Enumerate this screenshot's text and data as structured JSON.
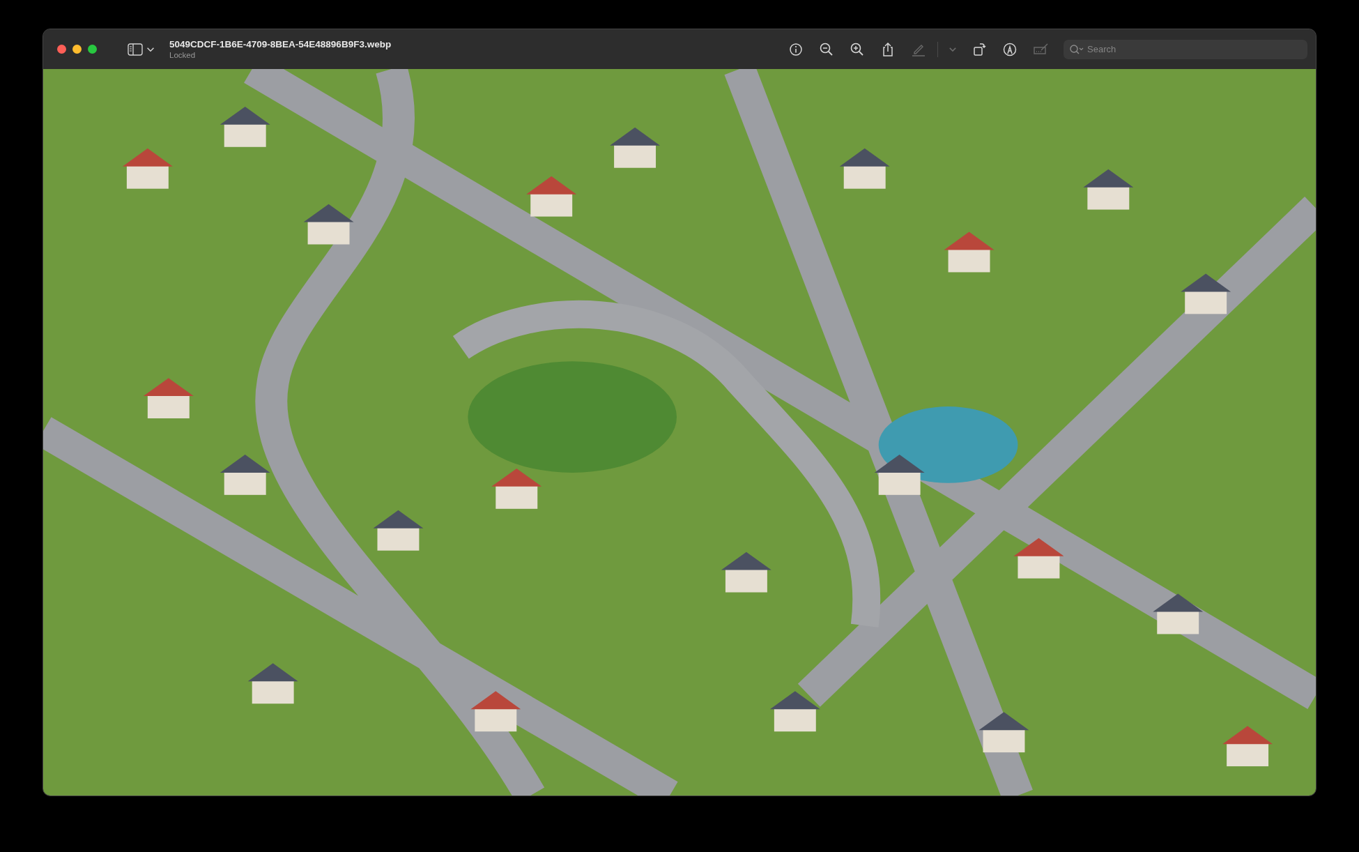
{
  "window": {
    "title": "5049CDCF-1B6E-4709-8BEA-54E48896B9F3.webp",
    "subtitle": "Locked"
  },
  "toolbar": [
    {
      "kind": "info",
      "disabled": false
    },
    {
      "kind": "zoom-out",
      "disabled": false
    },
    {
      "kind": "zoom-in",
      "disabled": false
    },
    {
      "kind": "share",
      "disabled": false
    },
    {
      "kind": "highlight",
      "disabled": true
    },
    {
      "kind": "chevron",
      "disabled": true
    },
    {
      "kind": "rotate",
      "disabled": false
    },
    {
      "kind": "markup",
      "disabled": false
    },
    {
      "kind": "sign",
      "disabled": true
    }
  ],
  "search": {
    "placeholder": "Search"
  }
}
